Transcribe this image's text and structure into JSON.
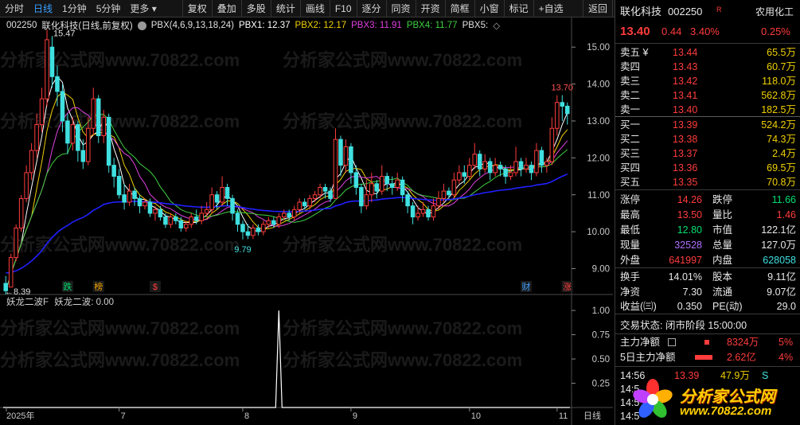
{
  "toolbar": {
    "left_items": [
      {
        "label": "分时",
        "active": false
      },
      {
        "label": "日线",
        "active": true
      },
      {
        "label": "1分钟",
        "active": false
      },
      {
        "label": "5分钟",
        "active": false
      },
      {
        "label": "更多 ▾",
        "active": false
      }
    ],
    "buttons": [
      "复权",
      "叠加",
      "多股",
      "统计",
      "画线",
      "F10",
      "逐分",
      "同资",
      "开资",
      "简框",
      "小窗",
      "标记",
      "+自选",
      "返回"
    ]
  },
  "legend": {
    "code": "002250",
    "name": "联化科技",
    "mode": "(日线,前复权)",
    "indicator": "PBX(4,6,9,13,18,24)",
    "pbx1": "PBX1: 12.37",
    "pbx2": "PBX2: 12.17",
    "pbx3": "PBX3: 11.91",
    "pbx4": "PBX4: 11.77",
    "pbx5": "PBX5:",
    "more": "◇"
  },
  "indicator_legend": {
    "name": "妖龙二波F",
    "line": "妖龙二波: 0.00"
  },
  "chart_data": {
    "type": "candlestick",
    "price_axis": {
      "min": 8.3,
      "max": 15.5,
      "ticks": [
        9.0,
        10.0,
        11.0,
        12.0,
        13.0,
        14.0,
        15.0
      ],
      "tick_labels": [
        "9.00",
        "10.00",
        "11.00",
        "12.00",
        "13.00",
        "14.00",
        "15.00"
      ]
    },
    "indicator_axis": {
      "min": 0,
      "max": 1.05,
      "ticks": [
        0.25,
        0.5,
        0.75,
        1.0
      ],
      "tick_labels": [
        "0.25",
        "0.50",
        "0.75",
        "1.00"
      ]
    },
    "x_labels": [
      {
        "label": "2025年",
        "index": 0
      },
      {
        "label": "7",
        "index": 22
      },
      {
        "label": "8",
        "index": 46
      },
      {
        "label": "9",
        "index": 67
      },
      {
        "label": "10",
        "index": 90
      },
      {
        "label": "11",
        "index": 107
      }
    ],
    "annotations": {
      "high_label": "15.47",
      "low_label": "9.79",
      "recent_high_label": "13.70",
      "start_low_label": "8.39"
    },
    "markers": [
      {
        "label": "跌",
        "index": 12,
        "color": "#00e070"
      },
      {
        "label": "榜",
        "index": 18,
        "color": "#f0a000"
      },
      {
        "label": "$",
        "index": 29,
        "color": "#ff3c3c"
      },
      {
        "label": "财",
        "index": 101,
        "color": "#40a0ff"
      },
      {
        "label": "涨",
        "index": 109,
        "color": "#ff3c3c"
      }
    ],
    "period_label": "日线",
    "candles": [
      [
        8.6,
        8.4,
        8.8,
        8.3
      ],
      [
        8.5,
        9.3,
        9.4,
        8.5
      ],
      [
        9.3,
        10.1,
        10.2,
        9.2
      ],
      [
        10.1,
        10.9,
        11.0,
        10.0
      ],
      [
        10.9,
        11.6,
        11.8,
        10.8
      ],
      [
        11.6,
        12.2,
        12.4,
        11.4
      ],
      [
        12.2,
        12.9,
        13.2,
        12.0
      ],
      [
        12.9,
        13.6,
        13.9,
        12.7
      ],
      [
        13.6,
        15.2,
        15.47,
        13.4
      ],
      [
        15.0,
        14.2,
        15.3,
        13.9
      ],
      [
        14.2,
        13.8,
        14.5,
        13.4
      ],
      [
        13.8,
        13.0,
        14.0,
        12.7
      ],
      [
        13.0,
        12.4,
        13.2,
        12.1
      ],
      [
        12.4,
        12.9,
        13.1,
        12.2
      ],
      [
        12.9,
        12.2,
        13.0,
        11.9
      ],
      [
        12.2,
        11.9,
        12.5,
        11.7
      ],
      [
        11.9,
        12.8,
        13.1,
        11.8
      ],
      [
        12.8,
        13.6,
        13.9,
        12.6
      ],
      [
        13.6,
        12.6,
        13.7,
        12.4
      ],
      [
        12.6,
        13.1,
        13.3,
        12.4
      ],
      [
        13.1,
        11.8,
        13.2,
        11.6
      ],
      [
        11.8,
        11.5,
        12.0,
        11.2
      ],
      [
        11.5,
        11.0,
        11.7,
        10.9
      ],
      [
        11.0,
        10.8,
        11.3,
        10.6
      ],
      [
        10.8,
        11.1,
        11.3,
        10.7
      ],
      [
        11.1,
        10.9,
        11.2,
        10.7
      ],
      [
        10.9,
        10.7,
        11.0,
        10.5
      ],
      [
        10.7,
        10.8,
        10.9,
        10.6
      ],
      [
        10.8,
        10.5,
        10.9,
        10.4
      ],
      [
        10.5,
        10.6,
        10.7,
        10.3
      ],
      [
        10.6,
        10.4,
        10.7,
        10.3
      ],
      [
        10.4,
        10.2,
        10.5,
        10.1
      ],
      [
        10.2,
        10.4,
        10.5,
        10.1
      ],
      [
        10.4,
        10.3,
        10.5,
        10.2
      ],
      [
        10.3,
        10.1,
        10.4,
        10.0
      ],
      [
        10.1,
        10.2,
        10.3,
        10.0
      ],
      [
        10.2,
        10.4,
        10.5,
        10.1
      ],
      [
        10.4,
        10.3,
        10.6,
        10.2
      ],
      [
        10.3,
        10.5,
        10.7,
        10.2
      ],
      [
        10.5,
        10.6,
        10.8,
        10.4
      ],
      [
        10.6,
        11.0,
        11.2,
        10.5
      ],
      [
        11.0,
        10.8,
        11.1,
        10.6
      ],
      [
        10.8,
        11.2,
        11.5,
        10.7
      ],
      [
        11.2,
        10.9,
        11.3,
        10.7
      ],
      [
        10.9,
        10.5,
        11.0,
        10.3
      ],
      [
        10.5,
        10.2,
        10.6,
        10.0
      ],
      [
        10.2,
        10.0,
        10.3,
        9.79
      ],
      [
        10.0,
        9.9,
        10.2,
        9.8
      ],
      [
        9.9,
        10.1,
        10.2,
        9.8
      ],
      [
        10.1,
        10.0,
        10.2,
        9.9
      ],
      [
        10.0,
        10.2,
        10.3,
        9.9
      ],
      [
        10.2,
        10.3,
        10.4,
        10.1
      ],
      [
        10.3,
        10.2,
        10.4,
        10.1
      ],
      [
        10.2,
        10.4,
        10.5,
        10.1
      ],
      [
        10.4,
        10.5,
        10.6,
        10.3
      ],
      [
        10.5,
        10.4,
        10.6,
        10.3
      ],
      [
        10.4,
        10.6,
        10.7,
        10.3
      ],
      [
        10.6,
        10.8,
        10.9,
        10.5
      ],
      [
        10.8,
        10.7,
        10.9,
        10.6
      ],
      [
        10.7,
        10.9,
        11.0,
        10.6
      ],
      [
        10.9,
        11.0,
        11.1,
        10.8
      ],
      [
        11.0,
        11.2,
        11.3,
        10.9
      ],
      [
        11.2,
        11.1,
        11.3,
        10.9
      ],
      [
        11.1,
        10.9,
        11.2,
        10.8
      ],
      [
        10.9,
        12.5,
        12.8,
        10.9
      ],
      [
        12.5,
        11.8,
        12.6,
        11.5
      ],
      [
        11.8,
        12.3,
        12.5,
        11.6
      ],
      [
        12.3,
        11.6,
        12.4,
        11.3
      ],
      [
        11.6,
        11.2,
        11.8,
        11.0
      ],
      [
        11.2,
        10.7,
        11.3,
        10.5
      ],
      [
        10.7,
        11.0,
        11.4,
        10.6
      ],
      [
        11.0,
        11.3,
        11.6,
        10.8
      ],
      [
        11.3,
        11.1,
        11.4,
        10.9
      ],
      [
        11.1,
        11.5,
        11.8,
        11.0
      ],
      [
        11.5,
        11.3,
        11.6,
        11.1
      ],
      [
        11.3,
        11.2,
        11.5,
        11.0
      ],
      [
        11.2,
        11.4,
        11.6,
        11.1
      ],
      [
        11.4,
        11.0,
        11.5,
        10.8
      ],
      [
        11.0,
        10.7,
        11.1,
        10.5
      ],
      [
        10.7,
        10.4,
        10.8,
        10.2
      ],
      [
        10.4,
        10.5,
        10.7,
        10.3
      ],
      [
        10.5,
        10.6,
        10.8,
        10.4
      ],
      [
        10.6,
        10.4,
        10.7,
        10.3
      ],
      [
        10.4,
        10.7,
        10.9,
        10.3
      ],
      [
        10.7,
        10.9,
        11.1,
        10.6
      ],
      [
        10.9,
        11.1,
        11.3,
        10.8
      ],
      [
        11.1,
        11.0,
        11.2,
        10.9
      ],
      [
        11.0,
        11.4,
        11.6,
        10.9
      ],
      [
        11.4,
        11.6,
        11.8,
        11.3
      ],
      [
        11.6,
        11.5,
        11.8,
        11.3
      ],
      [
        11.5,
        11.8,
        12.0,
        11.4
      ],
      [
        11.8,
        12.1,
        12.4,
        11.7
      ],
      [
        12.1,
        11.7,
        12.2,
        11.5
      ],
      [
        11.7,
        11.9,
        12.1,
        11.6
      ],
      [
        11.9,
        11.6,
        12.0,
        11.4
      ],
      [
        11.6,
        11.8,
        12.0,
        11.5
      ],
      [
        11.8,
        11.7,
        11.9,
        11.5
      ],
      [
        11.7,
        11.5,
        11.8,
        11.3
      ],
      [
        11.5,
        11.6,
        11.8,
        11.4
      ],
      [
        11.6,
        11.9,
        12.3,
        11.5
      ],
      [
        11.9,
        11.7,
        12.0,
        11.5
      ],
      [
        11.7,
        11.8,
        12.0,
        11.6
      ],
      [
        11.8,
        11.6,
        11.9,
        11.4
      ],
      [
        11.6,
        12.2,
        12.4,
        11.5
      ],
      [
        12.2,
        11.8,
        12.3,
        11.6
      ],
      [
        11.8,
        11.9,
        12.0,
        11.6
      ],
      [
        11.9,
        12.8,
        13.1,
        11.8
      ],
      [
        12.8,
        13.5,
        13.7,
        12.6
      ],
      [
        13.5,
        13.4,
        13.7,
        13.0
      ],
      [
        13.4,
        13.2,
        13.5,
        12.9
      ]
    ],
    "indicator_values": {
      "spike_index": 53,
      "spike_value": 1.0
    }
  },
  "right_panel": {
    "title_name": "联化科技",
    "title_code": "002250",
    "title_flag": "R",
    "sector": "农用化工",
    "price": "13.40",
    "change": "0.44",
    "change_pct": "3.40%",
    "sector_pct": "0.25%",
    "asks": [
      {
        "label": "卖五 ¥",
        "price": "13.44",
        "vol": "65.5万"
      },
      {
        "label": "卖四",
        "price": "13.43",
        "vol": "60.7万"
      },
      {
        "label": "卖三",
        "price": "13.42",
        "vol": "118.0万"
      },
      {
        "label": "卖二",
        "price": "13.41",
        "vol": "562.8万"
      },
      {
        "label": "卖一",
        "price": "13.40",
        "vol": "182.5万"
      }
    ],
    "bids": [
      {
        "label": "买一",
        "price": "13.39",
        "vol": "524.2万"
      },
      {
        "label": "买二",
        "price": "13.38",
        "vol": "74.3万"
      },
      {
        "label": "买三",
        "price": "13.37",
        "vol": "2.4万"
      },
      {
        "label": "买四",
        "price": "13.36",
        "vol": "69.5万"
      },
      {
        "label": "买五",
        "price": "13.35",
        "vol": "70.8万"
      }
    ],
    "stats": [
      {
        "l1": "涨停",
        "v1": "14.26",
        "c1": "red",
        "l2": "跌停",
        "v2": "11.66",
        "c2": "green"
      },
      {
        "l1": "最高",
        "v1": "13.50",
        "c1": "red",
        "l2": "量比",
        "v2": "1.46",
        "c2": "red"
      },
      {
        "l1": "最低",
        "v1": "12.80",
        "c1": "green",
        "l2": "市值",
        "v2": "122.1亿",
        "c2": "white"
      },
      {
        "l1": "现量",
        "v1": "32528",
        "c1": "purple",
        "l2": "总量",
        "v2": "127.0万",
        "c2": "white"
      },
      {
        "l1": "外盘",
        "v1": "641997",
        "c1": "red",
        "l2": "内盘",
        "v2": "628058",
        "c2": "cyan"
      }
    ],
    "stats2": [
      {
        "l1": "换手",
        "v1": "14.01%",
        "c1": "white",
        "l2": "股本",
        "v2": "9.11亿",
        "c2": "white"
      },
      {
        "l1": "净资",
        "v1": "7.30",
        "c1": "white",
        "l2": "流通",
        "v2": "9.07亿",
        "c2": "white"
      },
      {
        "l1": "收益(㈢)",
        "v1": "0.350",
        "c1": "white",
        "l2": "PE(动)",
        "v2": "29.0",
        "c2": "white"
      }
    ],
    "trade_status": "交易状态: 闭市阶段 15:00:00",
    "main_flow_label": "主力净额",
    "main_flow_value": "8324万",
    "main_flow_pct": "5%",
    "flow5_label": "5日主力净额",
    "flow5_value": "2.62亿",
    "flow5_pct": "4%",
    "ticks": [
      {
        "time": "14:56",
        "price": "13.39",
        "vol": "47.9万",
        "flag": "S"
      },
      {
        "time": "14:5",
        "price": "",
        "vol": "",
        "flag": ""
      },
      {
        "time": "14:5",
        "price": "",
        "vol": "",
        "flag": ""
      },
      {
        "time": "14:5",
        "price": "",
        "vol": "",
        "flag": ""
      }
    ]
  },
  "logo": {
    "text": "分析家公式网",
    "url": "www.70822.com"
  },
  "watermark": "分析家公式网www.70822.com",
  "colors": {
    "up": "#ff3c3c",
    "down": "#40e0e0",
    "ma1": "#ffffff",
    "ma2": "#f0d000",
    "ma3": "#e040e0",
    "ma4": "#40d040",
    "ma5": "#2020ff",
    "grid": "#2a2a2a"
  }
}
